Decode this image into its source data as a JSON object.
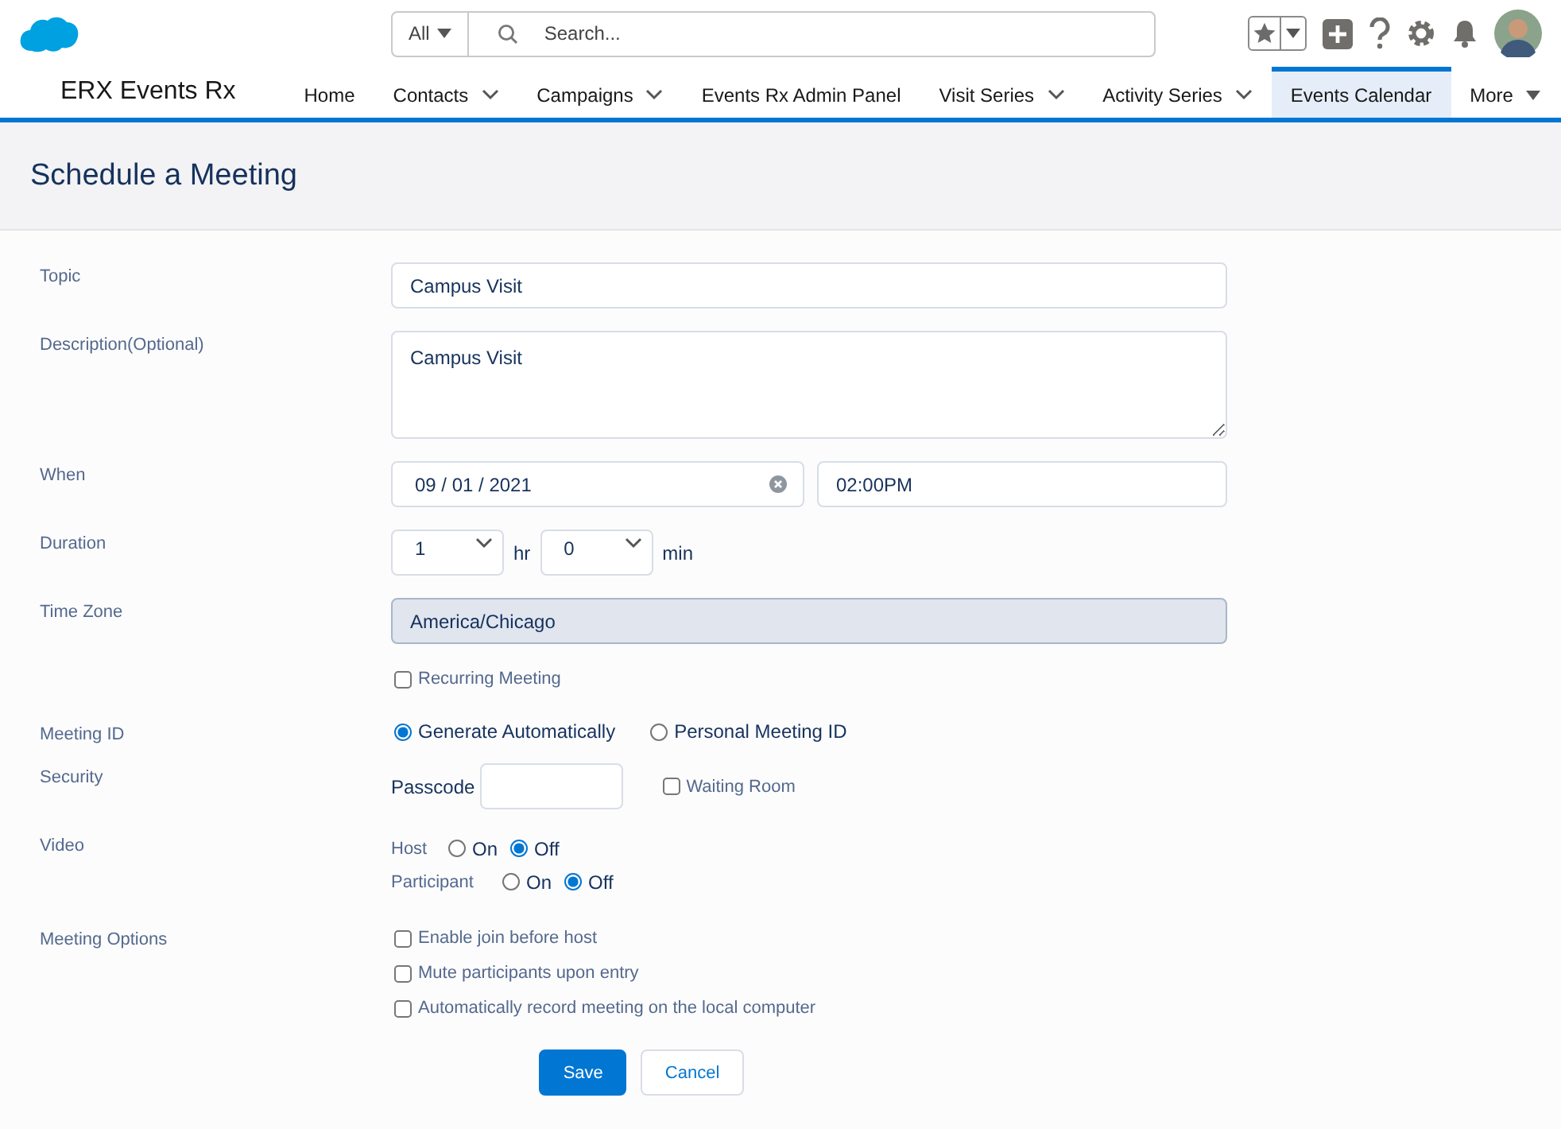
{
  "header": {
    "search_scope": "All",
    "search_placeholder": "Search..."
  },
  "app_name": "ERX Events Rx",
  "nav": [
    {
      "label": "Home",
      "dropdown": false,
      "selected": false
    },
    {
      "label": "Contacts",
      "dropdown": true,
      "selected": false
    },
    {
      "label": "Campaigns",
      "dropdown": true,
      "selected": false
    },
    {
      "label": "Events Rx Admin Panel",
      "dropdown": false,
      "selected": false
    },
    {
      "label": "Visit Series",
      "dropdown": true,
      "selected": false
    },
    {
      "label": "Activity Series",
      "dropdown": true,
      "selected": false
    },
    {
      "label": "Events Calendar",
      "dropdown": false,
      "selected": true
    }
  ],
  "more": "More",
  "page_title": "Schedule a Meeting",
  "form": {
    "topic": {
      "label": "Topic",
      "value": "Campus Visit"
    },
    "description": {
      "label": "Description(Optional)",
      "value": "Campus Visit"
    },
    "when": {
      "label": "When",
      "date": "09 / 01 / 2021",
      "time": "02:00PM"
    },
    "duration": {
      "label": "Duration",
      "hours": "1",
      "hours_unit": "hr",
      "minutes": "0",
      "minutes_unit": "min"
    },
    "time_zone": {
      "label": "Time Zone",
      "value": "America/Chicago"
    },
    "recurring": {
      "label": "Recurring Meeting",
      "checked": false
    },
    "meeting_id": {
      "label": "Meeting ID",
      "options": [
        {
          "label": "Generate Automatically",
          "selected": true
        },
        {
          "label": "Personal Meeting ID",
          "selected": false
        }
      ]
    },
    "security": {
      "label": "Security",
      "passcode_label": "Passcode",
      "waiting_room": {
        "label": "Waiting Room",
        "checked": false
      }
    },
    "video": {
      "label": "Video",
      "rows": [
        {
          "label": "Host",
          "options": [
            {
              "label": "On",
              "selected": false
            },
            {
              "label": "Off",
              "selected": true
            }
          ]
        },
        {
          "label": "Participant",
          "options": [
            {
              "label": "On",
              "selected": false
            },
            {
              "label": "Off",
              "selected": true
            }
          ]
        }
      ]
    },
    "meeting_options": {
      "label": "Meeting Options",
      "items": [
        {
          "label": "Enable join before host",
          "checked": false
        },
        {
          "label": "Mute participants upon entry",
          "checked": false
        },
        {
          "label": "Automatically record meeting on the local computer",
          "checked": false
        }
      ]
    }
  },
  "buttons": [
    {
      "label": "Save",
      "kind": "primary"
    },
    {
      "label": "Cancel",
      "kind": "secondary"
    }
  ]
}
